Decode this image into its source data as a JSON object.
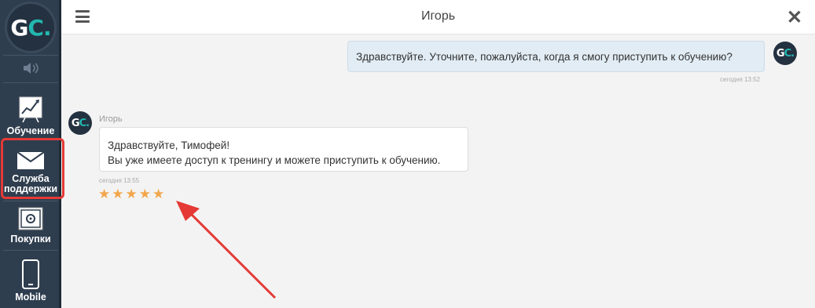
{
  "app": {
    "logo_text": "GC.",
    "accent_color": "#22b8b0",
    "sidebar_bg": "#2f3e4f"
  },
  "sidebar": {
    "items": [
      {
        "label": "Обучение",
        "icon": "chart-board-icon"
      },
      {
        "label_line1": "Служба",
        "label_line2": "поддержки",
        "icon": "envelope-icon",
        "active": true
      },
      {
        "label": "Покупки",
        "icon": "safe-icon"
      },
      {
        "label": "Mobile",
        "icon": "smartphone-icon"
      }
    ],
    "sound_icon": "speaker-icon"
  },
  "header": {
    "title": "Игорь",
    "menu_icon": "hamburger-icon",
    "close_icon": "close-icon"
  },
  "messages": [
    {
      "direction": "outgoing",
      "text": "Здравствуйте. Уточните, пожалуйста, когда я смогу приступить к обучению?",
      "time": "сегодня 13:52"
    },
    {
      "direction": "incoming",
      "sender": "Игорь",
      "line1": "Здравствуйте, Тимофей!",
      "line2": "Вы уже имеете доступ к тренингу и можете приступить к обучению.",
      "time": "сегодня 13:55",
      "rating": 5,
      "rating_max": 5
    }
  ],
  "annotation": {
    "arrow_color": "#e53935",
    "highlight_color": "#e53935"
  }
}
